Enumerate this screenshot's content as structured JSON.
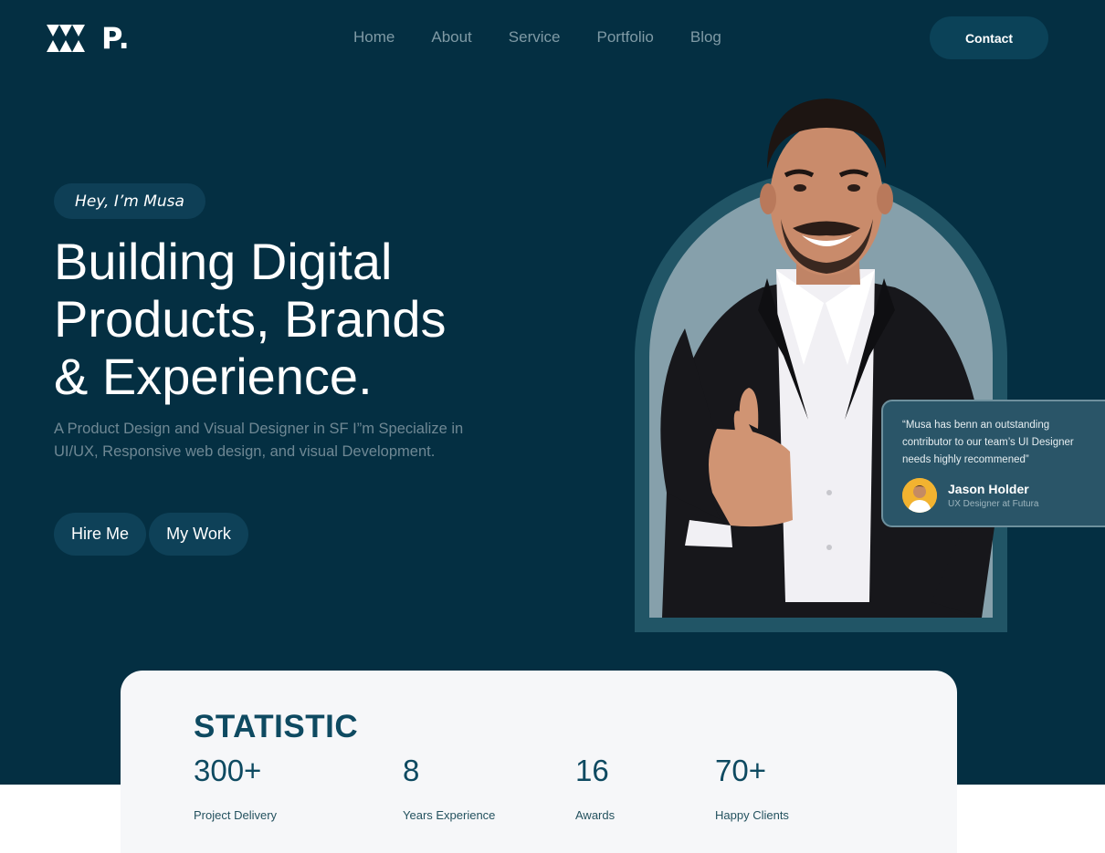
{
  "brand": {
    "logo_letter": "P."
  },
  "nav": {
    "items": [
      {
        "label": "Home"
      },
      {
        "label": "About"
      },
      {
        "label": "Service"
      },
      {
        "label": "Portfolio"
      },
      {
        "label": "Blog"
      }
    ],
    "contact_label": "Contact"
  },
  "hero": {
    "greeting": "Hey, I’m Musa",
    "headline_lines": [
      "Building Digital",
      "Products, Brands",
      "& Experience."
    ],
    "subtitle": "A Product Design and Visual Designer in SF I”m Specialize in UI/UX, Responsive web design, and visual Development.",
    "hire_label": "Hire Me",
    "work_label": "My Work"
  },
  "testimonial": {
    "quote": "“Musa has benn an outstanding contributor to our team’s UI Designer needs highly recommened”",
    "name": "Jason Holder",
    "role": "UX Designer at Futura"
  },
  "stats": {
    "title": "STATISTIC",
    "items": [
      {
        "value": "300+",
        "label": "Project Delivery"
      },
      {
        "value": "8",
        "label": "Years Experience"
      },
      {
        "value": "16",
        "label": "Awards"
      },
      {
        "value": "70+",
        "label": "Happy Clients"
      }
    ]
  },
  "colors": {
    "background": "#042f42",
    "button": "#0e4158",
    "accent_text": "#0e4a61",
    "arch": "#215566",
    "arch_inner": "#86a0ab"
  },
  "icons": [
    "logo-mark-icon",
    "avatar-icon",
    "portrait-image"
  ]
}
